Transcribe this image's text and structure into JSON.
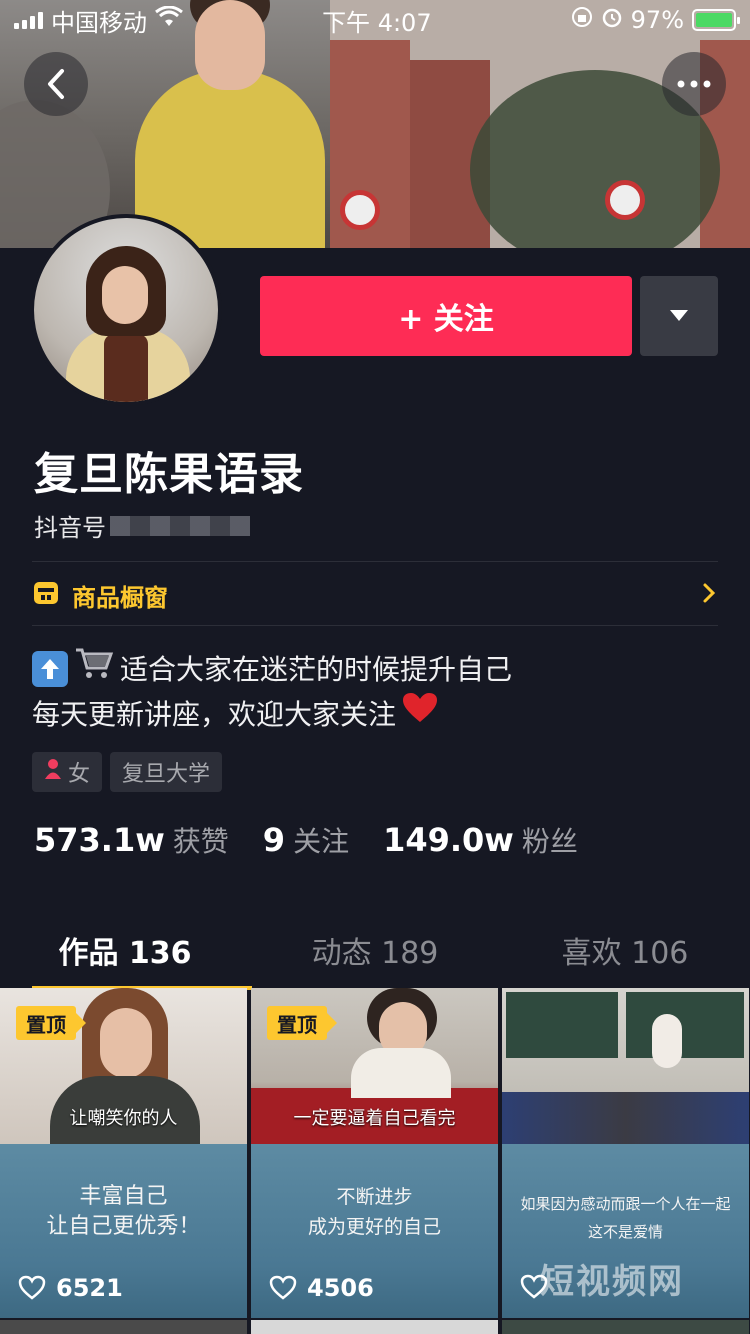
{
  "status_bar": {
    "carrier": "中国移动",
    "time": "下午 4:07",
    "battery": "97%"
  },
  "profile": {
    "name": "复旦陈果语录",
    "douyin_id_label": "抖音号",
    "follow_label": "+ 关注",
    "shop_label": "商品橱窗",
    "bio_line1": "适合大家在迷茫的时候提升自己",
    "bio_line2": "每天更新讲座，欢迎大家关注",
    "tags": [
      "女",
      "复旦大学"
    ],
    "stats": [
      {
        "num": "573.1w",
        "label": "获赞"
      },
      {
        "num": "9",
        "label": "关注"
      },
      {
        "num": "149.0w",
        "label": "粉丝"
      }
    ]
  },
  "tabs": [
    {
      "label": "作品 136"
    },
    {
      "label": "动态 189"
    },
    {
      "label": "喜欢 106"
    }
  ],
  "videos": [
    {
      "pinned": "置顶",
      "caption_top": "让嘲笑你的人",
      "board_line1": "丰富自己",
      "board_line2": "让自己更优秀！",
      "likes": "6521"
    },
    {
      "pinned": "置顶",
      "caption_top": "一定要逼着自己看完",
      "board_line1": "不断进步",
      "board_line2": "成为更好的自己",
      "likes": "4506"
    },
    {
      "pinned": "",
      "caption_top": "",
      "board_line1": "如果因为感动而跟一个人在一起",
      "board_line2": "这不是爱情",
      "likes": ""
    }
  ],
  "watermark": "短视频网",
  "colors": {
    "background": "#161823",
    "follow": "#fe2c55",
    "accent": "#fdc72f",
    "battery": "#4cd964"
  }
}
